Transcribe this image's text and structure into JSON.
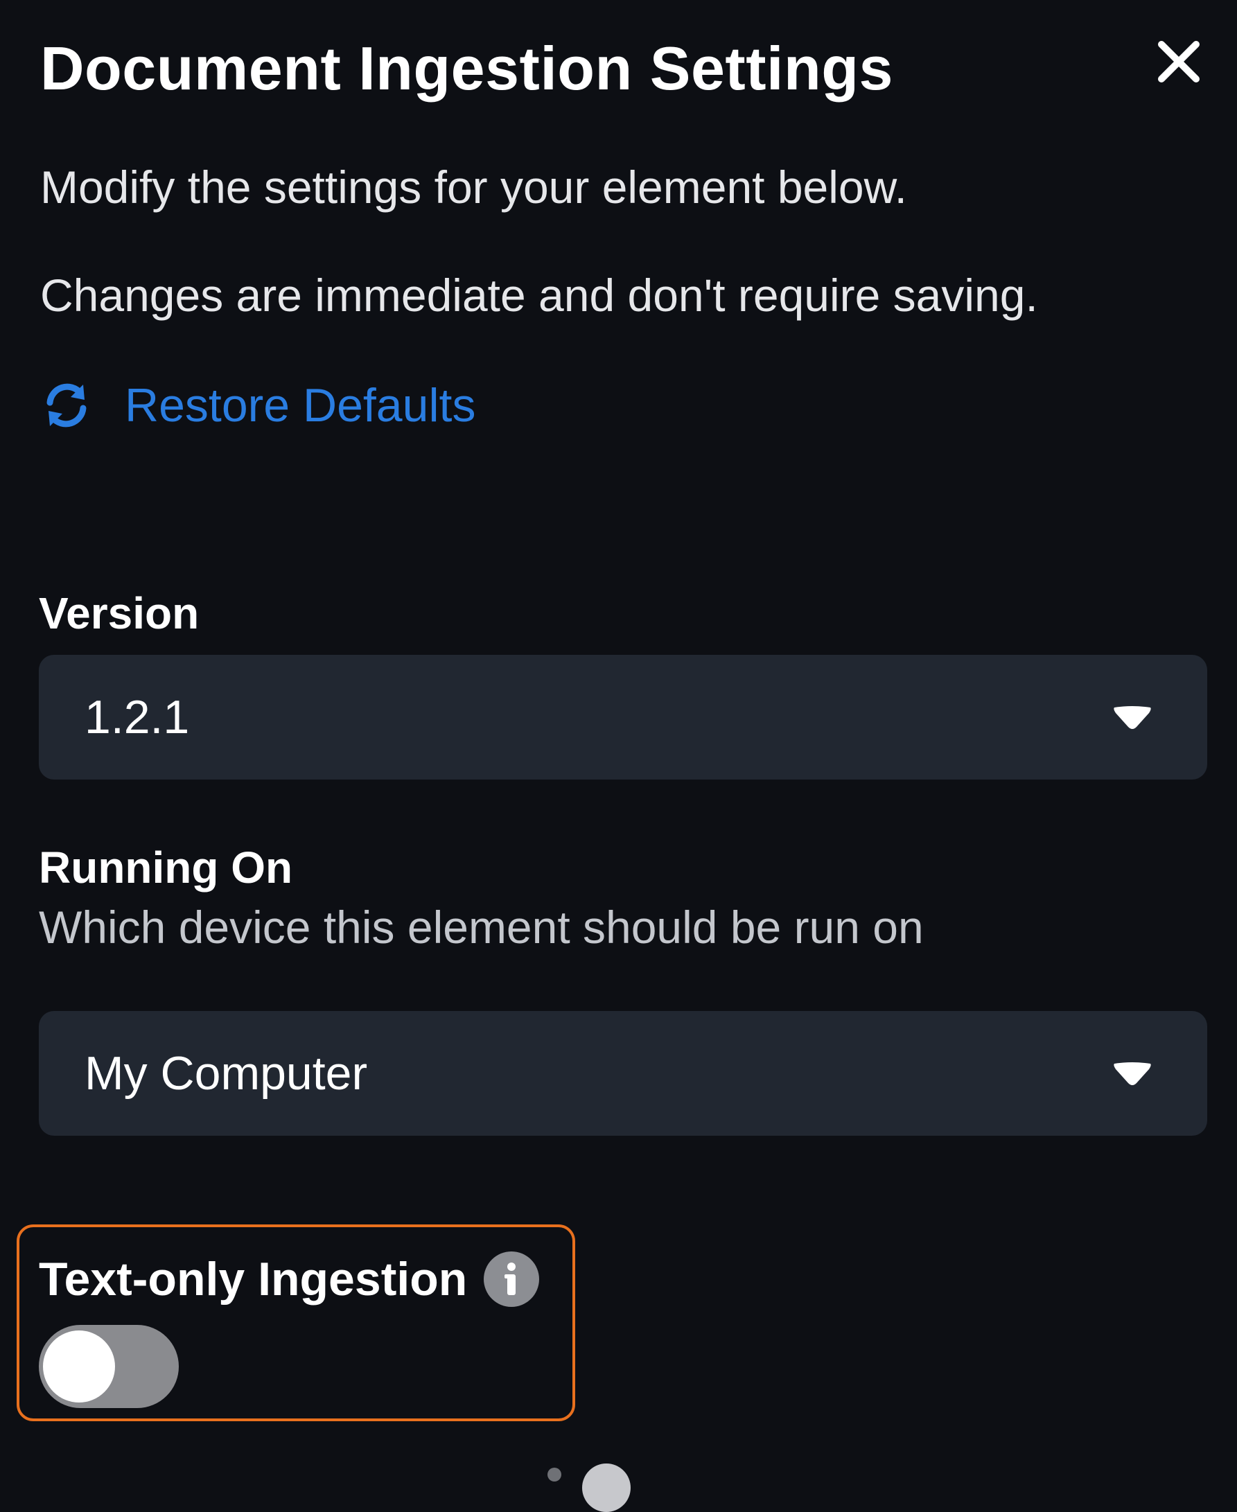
{
  "dialog": {
    "title": "Document Ingestion Settings",
    "close_icon": "close-icon",
    "description_line1": "Modify the settings for your element below.",
    "description_line2": "Changes are immediate and don't require saving.",
    "restore_defaults_label": "Restore Defaults",
    "restore_icon": "refresh-icon"
  },
  "fields": {
    "version": {
      "label": "Version",
      "selected": "1.2.1"
    },
    "running_on": {
      "label": "Running On",
      "help": "Which device this element should be run on",
      "selected": "My Computer"
    },
    "text_only_ingestion": {
      "label": "Text-only Ingestion",
      "info_icon": "info-icon",
      "enabled": false
    }
  },
  "colors": {
    "background": "#0d0f14",
    "select_background": "#212731",
    "link_blue": "#2a7de1",
    "highlight_orange": "#e8701e",
    "toggle_off": "#8a8b8f"
  }
}
